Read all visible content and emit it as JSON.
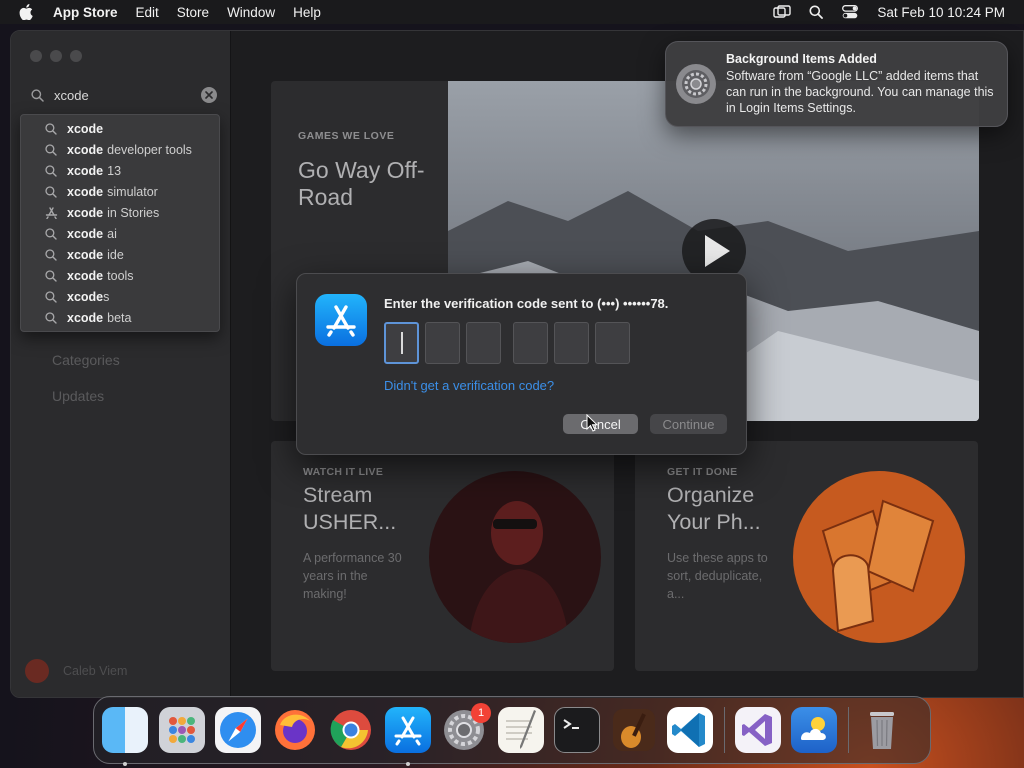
{
  "menubar": {
    "app_name": "App Store",
    "menus": [
      "Edit",
      "Store",
      "Window",
      "Help"
    ],
    "clock": "Sat Feb 10  10:24 PM"
  },
  "sidebar": {
    "search_value": "xcode",
    "suggestions": [
      {
        "bold": "xcode",
        "rest": "",
        "icon": "search-icon"
      },
      {
        "bold": "xcode",
        "rest": "developer tools",
        "icon": "search-icon"
      },
      {
        "bold": "xcode",
        "rest": "13",
        "icon": "search-icon"
      },
      {
        "bold": "xcode",
        "rest": "simulator",
        "icon": "search-icon"
      },
      {
        "bold": "xcode",
        "rest": "in Stories",
        "icon": "app-store-icon"
      },
      {
        "bold": "xcode",
        "rest": "ai",
        "icon": "search-icon"
      },
      {
        "bold": "xcode",
        "rest": "ide",
        "icon": "search-icon"
      },
      {
        "bold": "xcode",
        "rest": "tools",
        "icon": "search-icon"
      },
      {
        "bold": "xcode",
        "rest": "s",
        "icon": "search-icon"
      },
      {
        "bold": "xcode",
        "rest": "beta",
        "icon": "search-icon"
      }
    ],
    "links": [
      "Categories",
      "Updates"
    ],
    "account_name": "Caleb Viem"
  },
  "hero": {
    "eyebrow": "GAMES WE LOVE",
    "title": "Go Way Off-Road"
  },
  "cards": [
    {
      "eyebrow": "WATCH IT LIVE",
      "title": "Stream USHER...",
      "desc": "A performance 30 years in the making!"
    },
    {
      "eyebrow": "GET IT DONE",
      "title": "Organize Your Ph...",
      "desc": "Use these apps to sort, deduplicate, a..."
    }
  ],
  "dialog": {
    "prompt": "Enter the verification code sent to (•••) ••••••78.",
    "code_digits": [
      "",
      "",
      "",
      "",
      "",
      ""
    ],
    "resend_link": "Didn't get a verification code?",
    "cancel_label": "Cancel",
    "continue_label": "Continue"
  },
  "notification": {
    "title": "Background Items Added",
    "body": "Software from “Google LLC” added items that can run in the background. You can manage this in Login Items Settings."
  },
  "dock": {
    "apps": [
      "finder-icon",
      "launchpad-icon",
      "safari-icon",
      "firefox-icon",
      "chrome-icon",
      "app-store-icon",
      "system-settings-icon",
      "textedit-icon",
      "terminal-icon",
      "garageband-icon",
      "vscode-icon",
      "visual-studio-icon",
      "weather-icon",
      "trash-icon"
    ],
    "settings_badge": "1"
  },
  "colors": {
    "accent": "#3b8fe8",
    "focus_ring": "#5e94d8",
    "badge": "#f24236"
  }
}
